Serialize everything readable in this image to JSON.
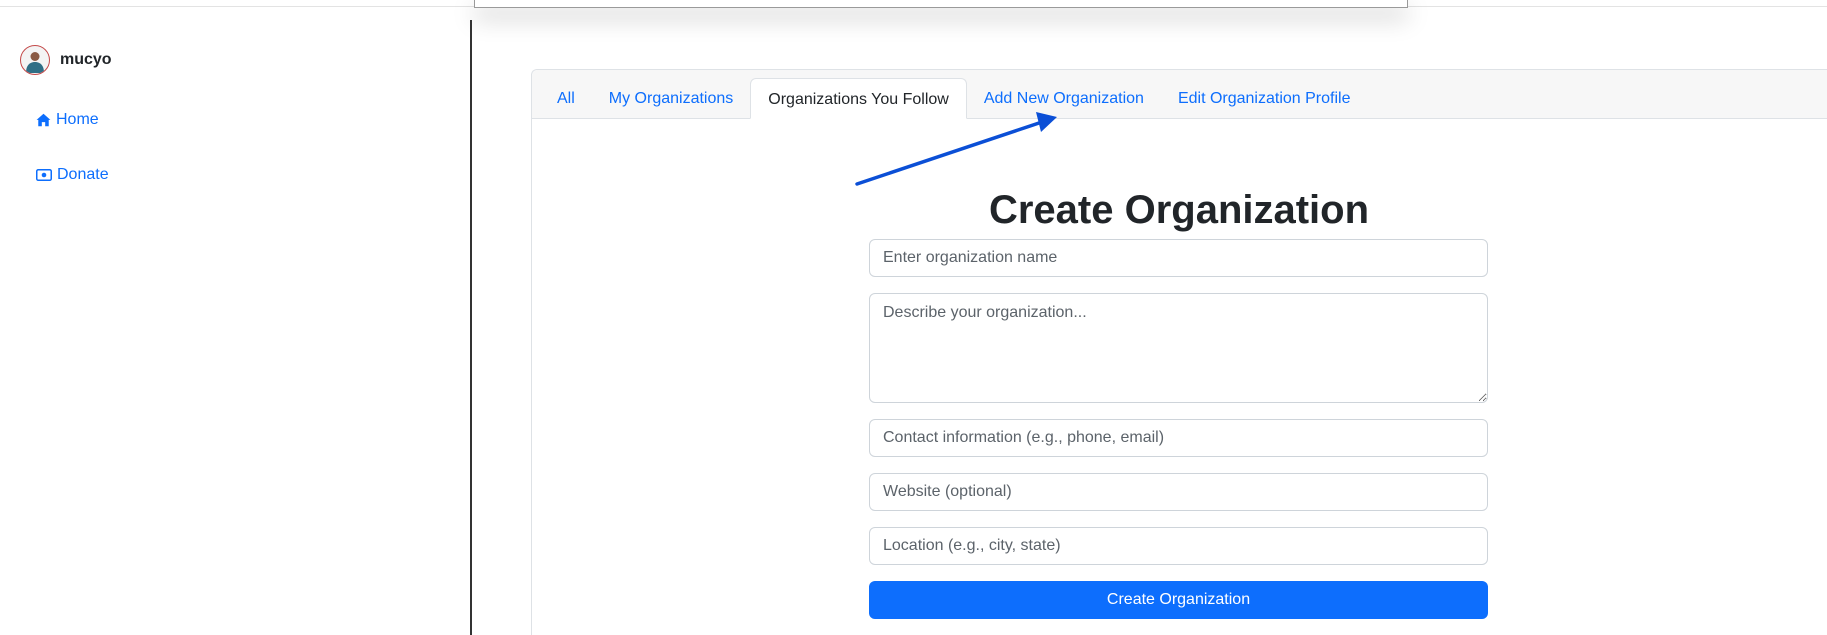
{
  "user": {
    "name": "mucyo"
  },
  "sidebar": {
    "items": [
      {
        "label": "Home",
        "icon": "home-icon"
      },
      {
        "label": "Donate",
        "icon": "cash-icon"
      }
    ]
  },
  "tabs": [
    {
      "label": "All",
      "active": false
    },
    {
      "label": "My Organizations",
      "active": false
    },
    {
      "label": "Organizations You Follow",
      "active": true
    },
    {
      "label": "Add New Organization",
      "active": false
    },
    {
      "label": "Edit Organization Profile",
      "active": false
    }
  ],
  "form": {
    "title": "Create Organization",
    "name_placeholder": "Enter organization name",
    "description_placeholder": "Describe your organization...",
    "contact_placeholder": "Contact information (e.g., phone, email)",
    "website_placeholder": "Website (optional)",
    "location_placeholder": "Location (e.g., city, state)",
    "submit_label": "Create Organization"
  },
  "colors": {
    "link": "#0d6efd",
    "primary_button": "#0d6efd",
    "annotation_arrow": "#0b4fd6"
  }
}
